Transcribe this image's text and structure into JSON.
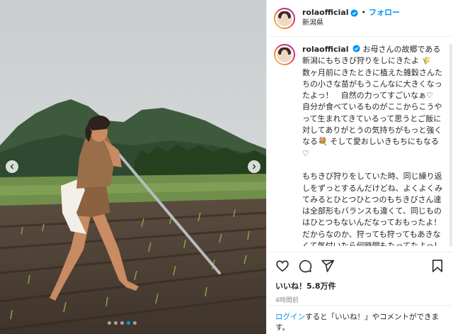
{
  "post": {
    "username": "rolaofficial",
    "follow_label": "フォロー",
    "separator": "•",
    "location": "新潟県",
    "caption_username": "rolaofficial",
    "caption_body": "お母さんの故郷である新潟にもちきび狩りをしにきたよ 🌾\n数ヶ月前にきたときに植えた雑穀さんたちの小さな苗がもうこんなに大きくなったよっ！　自然の力ってすごいなぁ♡\n自分が食べているものがここからこうやって生まれてきているって思うとご飯に対してありがとうの気持ちがもっと強くなる💐 そして愛おしいきもちにもなる♡\n\nもちきび狩りをしていた時、同じ繰り返しをずっとするんだけどね、よくよくみてみるとひとつひとつのもちきびさん達は全部形もバランスも違くて、同じものはひとつもないんだなっておもったよ！ だからなのか、狩っても狩ってもあきなくて気付いたら何時間もたってたよっ！ 楽しかった〜^o^",
    "likes_text": "いいね！5.8万件",
    "time_text": "4時間前",
    "login_link": "ログイン",
    "login_rest": "すると「いいね！」やコメントができます。",
    "carousel": {
      "count": 5,
      "active_index": 3
    }
  },
  "icons": {
    "verified": "verified-badge-icon",
    "like": "heart-icon",
    "comment": "comment-icon",
    "share": "paper-plane-icon",
    "save": "bookmark-icon",
    "prev": "chevron-left-icon",
    "next": "chevron-right-icon"
  },
  "colors": {
    "accent": "#0095f6",
    "text": "#262626",
    "muted": "#8e8e8e",
    "border": "#efefef"
  }
}
